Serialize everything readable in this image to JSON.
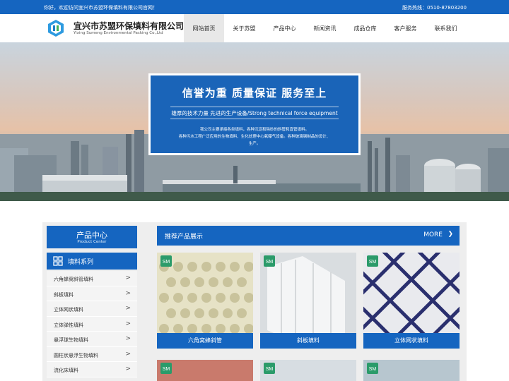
{
  "topbar": {
    "welcome": "你好，欢迎访问宜兴市苏盟环保填料有限公司官网！",
    "hotline": "服务热线：0510-87803200"
  },
  "brand": {
    "title": "宜兴市苏盟环保填料有限公司",
    "subtitle": "Yixing Sumeng Environmental Packing Co.,Ltd"
  },
  "nav": {
    "items": [
      {
        "label": "网站首页",
        "active": true
      },
      {
        "label": "关于苏盟"
      },
      {
        "label": "产品中心"
      },
      {
        "label": "新闻资讯"
      },
      {
        "label": "成品仓库"
      },
      {
        "label": "客户服务"
      },
      {
        "label": "联系我们"
      }
    ]
  },
  "banner": {
    "headline": "信誉为重  质量保证  服务至上",
    "tagline": "雄厚的技术力量 先进的生产设备/Strong technical force equipment",
    "desc_line1": "我公司主要承接各类填料，各种沉淀和除砂的斜管和直管填料。",
    "desc_line2": "各种污水工程广泛应用的生物填料、生化处理中心氧曝气设备。各种玻璃钢制品的设计、",
    "desc_line3": "生产。"
  },
  "sidebar": {
    "title": "产品中心",
    "subtitle": "Product Center",
    "category": "填料系列",
    "items": [
      {
        "label": "六角蜂窝斜管填料"
      },
      {
        "label": "斜板填料"
      },
      {
        "label": "立体网状填料"
      },
      {
        "label": "立体弹性填料"
      },
      {
        "label": "悬浮球生物填料"
      },
      {
        "label": "圆柱状悬浮生物填料"
      },
      {
        "label": "流化床填料"
      }
    ]
  },
  "recommend": {
    "title": "推荐产品展示",
    "more": "MORE",
    "products": [
      {
        "caption": "六角窝蜂斜管"
      },
      {
        "caption": "斜板填料"
      },
      {
        "caption": "立体网状填料"
      }
    ]
  },
  "colors": {
    "primary": "#1565c0",
    "panel": "#eeeeee"
  }
}
